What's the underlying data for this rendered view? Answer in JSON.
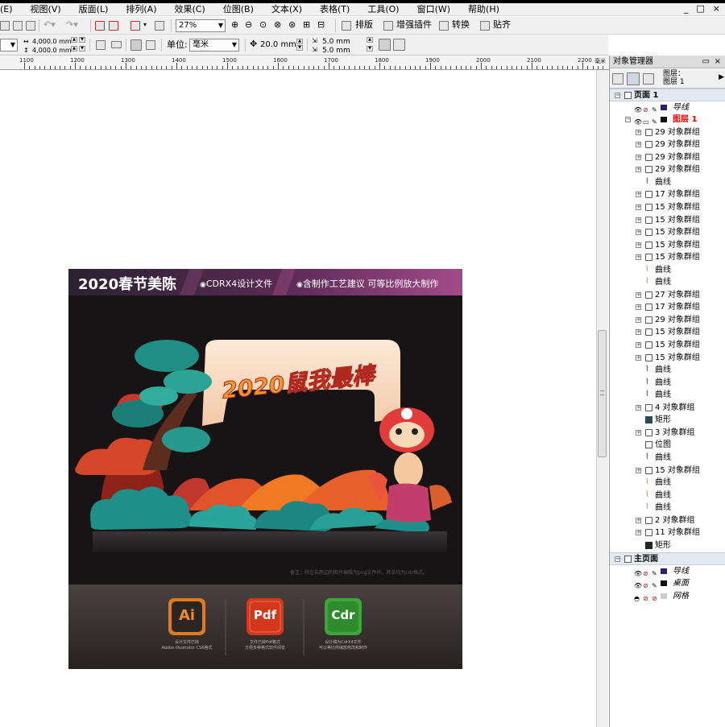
{
  "menu": [
    "(E)",
    "视图(V)",
    "版面(L)",
    "排列(A)",
    "效果(C)",
    "位图(B)",
    "文本(X)",
    "表格(T)",
    "工具(O)",
    "窗口(W)",
    "帮助(H)"
  ],
  "window_controls": [
    "_",
    "□",
    "×"
  ],
  "toolbar1": {
    "zoom": "27%",
    "plugins": [
      "排版",
      "增强插件",
      "转换",
      "贴齐"
    ]
  },
  "toolbar2": {
    "width": "4,000.0 mm",
    "height": "4,000.0 mm",
    "unit_label": "单位:",
    "unit_value": "毫米",
    "nudge": "20.0 mm",
    "dup_x": "5.0 mm",
    "dup_y": "5.0 mm"
  },
  "ruler": {
    "labels": [
      "1100",
      "1200",
      "1300",
      "1400",
      "1500",
      "1600",
      "1700",
      "1800",
      "1900",
      "2000",
      "2100",
      "2200"
    ],
    "unit": "毫米"
  },
  "artwork": {
    "banner_title": "2020春节美陈",
    "banner_tag1": "CDRX4设计文件",
    "banner_tag2": "含制作工艺建议 可等比例放大制作",
    "headline": "2020鼠我最棒",
    "note": "备注：除左右两边的图片编辑为png文件外，其余均为cdr格式。",
    "formats": [
      {
        "badge": "Ai",
        "line1": "设计文件已转",
        "line2": "Adobe Illustrator CS6格式",
        "color": "#e07a1e"
      },
      {
        "badge": "Pdf",
        "line1": "文件已转Pdf格式",
        "line2": "方便多种格式软件阅览",
        "color": "#d4381c"
      },
      {
        "badge": "Cdr",
        "line1": "设计稿为CdrX4文件",
        "line2": "可以等比例缩放修改和制作",
        "color": "#3da63a"
      }
    ]
  },
  "docker": {
    "title": "对象管理器",
    "layer_label1": "图层：",
    "layer_label2": "图层 1",
    "page1": "页面 1",
    "guides": "导线",
    "layer1": "图层 1",
    "objects": [
      "29 对象群组",
      "29 对象群组",
      "29 对象群组",
      "29 对象群组",
      "曲线",
      "17 对象群组",
      "15 对象群组",
      "15 对象群组",
      "15 对象群组",
      "15 对象群组",
      "15 对象群组",
      "曲线",
      "曲线",
      "27 对象群组",
      "17 对象群组",
      "29 对象群组",
      "15 对象群组",
      "15 对象群组",
      "15 对象群组",
      "曲线",
      "曲线",
      "曲线",
      "4 对象群组",
      "矩形",
      "3 对象群组",
      "位图",
      "曲线",
      "15 对象群组",
      "曲线",
      "曲线",
      "曲线",
      "2 对象群组",
      "11 对象群组",
      "矩形"
    ],
    "master": "主页面",
    "master_items": [
      "导线",
      "桌面",
      "网格"
    ]
  }
}
